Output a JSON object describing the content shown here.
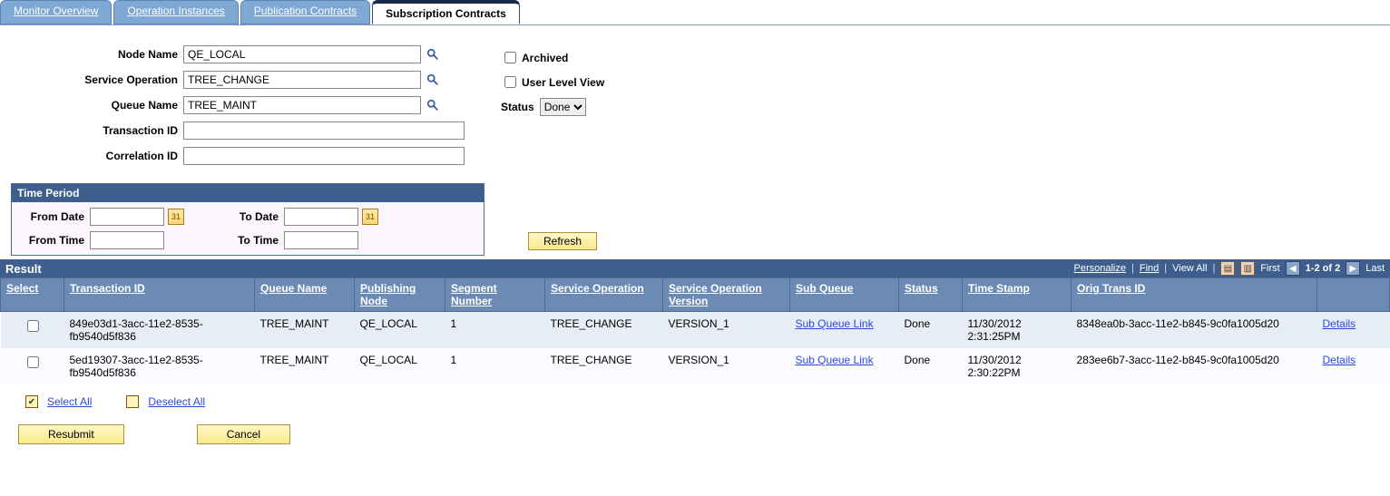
{
  "tabs": {
    "t0": "Monitor Overview",
    "t1": "Operation Instances",
    "t2": "Publication Contracts",
    "t3": "Subscription Contracts"
  },
  "filters": {
    "node_label": "Node Name",
    "node_value": "QE_LOCAL",
    "svcop_label": "Service Operation",
    "svcop_value": "TREE_CHANGE",
    "queue_label": "Queue Name",
    "queue_value": "TREE_MAINT",
    "txn_label": "Transaction ID",
    "txn_value": "",
    "corr_label": "Correlation ID",
    "corr_value": "",
    "archived_label": "Archived",
    "user_level_label": "User Level View",
    "status_label": "Status",
    "status_value": "Done"
  },
  "time_period": {
    "title": "Time Period",
    "from_date_label": "From Date",
    "from_date_value": "",
    "from_time_label": "From Time",
    "from_time_value": "",
    "to_date_label": "To Date",
    "to_date_value": "",
    "to_time_label": "To Time",
    "to_time_value": ""
  },
  "buttons": {
    "refresh": "Refresh",
    "resubmit": "Resubmit",
    "cancel": "Cancel",
    "select_all": "Select All",
    "deselect_all": "Deselect All"
  },
  "result": {
    "title": "Result",
    "toolbar": {
      "personalize": "Personalize",
      "find": "Find",
      "view_all": "View All",
      "first": "First",
      "range": "1-2 of 2",
      "last": "Last"
    },
    "columns": {
      "select": "Select",
      "txn": "Transaction ID",
      "queue": "Queue Name",
      "pubnode": "Publishing Node",
      "seg": "Segment Number",
      "svcop": "Service Operation",
      "svcver": "Service Operation Version",
      "subq": "Sub Queue",
      "status": "Status",
      "ts": "Time Stamp",
      "orig": "Orig Trans ID",
      "blank": ""
    },
    "rows": {
      "r0": {
        "txn": "849e03d1-3acc-11e2-8535-fb9540d5f836",
        "queue": "TREE_MAINT",
        "pubnode": "QE_LOCAL",
        "seg": "1",
        "svcop": "TREE_CHANGE",
        "svcver": "VERSION_1",
        "subq": "Sub Queue Link",
        "status": "Done",
        "ts": "11/30/2012 2:31:25PM",
        "orig": "8348ea0b-3acc-11e2-b845-9c0fa1005d20",
        "details": "Details"
      },
      "r1": {
        "txn": "5ed19307-3acc-11e2-8535-fb9540d5f836",
        "queue": "TREE_MAINT",
        "pubnode": "QE_LOCAL",
        "seg": "1",
        "svcop": "TREE_CHANGE",
        "svcver": "VERSION_1",
        "subq": "Sub Queue Link",
        "status": "Done",
        "ts": "11/30/2012 2:30:22PM",
        "orig": "283ee6b7-3acc-11e2-b845-9c0fa1005d20",
        "details": "Details"
      }
    }
  }
}
